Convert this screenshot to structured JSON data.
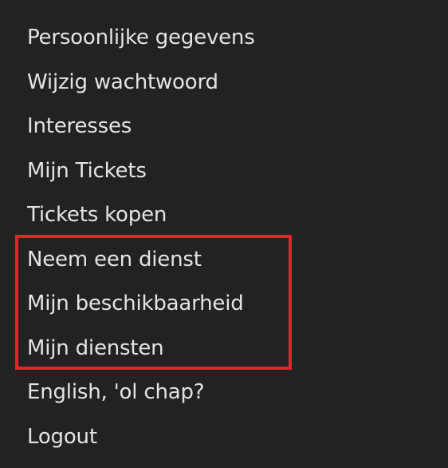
{
  "menu": {
    "items": [
      {
        "label": "Persoonlijke gegevens"
      },
      {
        "label": "Wijzig wachtwoord"
      },
      {
        "label": "Interesses"
      },
      {
        "label": "Mijn Tickets"
      },
      {
        "label": "Tickets kopen"
      },
      {
        "label": "Neem een dienst"
      },
      {
        "label": "Mijn beschikbaarheid"
      },
      {
        "label": "Mijn diensten"
      },
      {
        "label": "English, 'ol chap?"
      },
      {
        "label": "Logout"
      }
    ]
  },
  "colors": {
    "background": "#222222",
    "text": "#e4e4e4",
    "highlight": "#e8222a"
  }
}
